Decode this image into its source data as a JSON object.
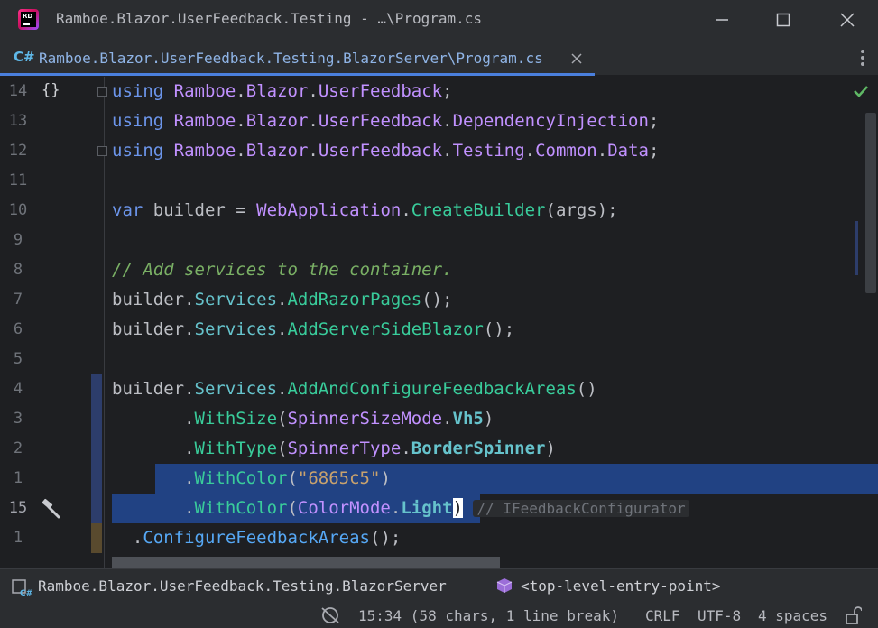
{
  "window": {
    "title": "Ramboe.Blazor.UserFeedback.Testing - …\\Program.cs",
    "app_logo_text": "RD"
  },
  "tab": {
    "lang_icon": "C#",
    "label": "Ramboe.Blazor.UserFeedback.Testing.BlazorServer\\Program.cs"
  },
  "editor": {
    "line_numbers": [
      "14",
      "13",
      "12",
      "11",
      "10",
      "9",
      "8",
      "7",
      "6",
      "5",
      "4",
      "3",
      "2",
      "1",
      "15",
      "1"
    ],
    "inlay_hint": "// IFeedbackConfigurator"
  },
  "navbar": {
    "project": "Ramboe.Blazor.UserFeedback.Testing.BlazorServer",
    "entry_point": "<top-level-entry-point>"
  },
  "status": {
    "position": "15:34 (58 chars, 1 line break)",
    "line_ending": "CRLF",
    "encoding": "UTF-8",
    "indent": "4 spaces"
  },
  "colors": {
    "accent": "#4a7fdd",
    "selection": "#214283",
    "background": "#1e1f22",
    "chrome": "#2b2d30"
  },
  "icons": [
    "rider-logo",
    "minimize-icon",
    "maximize-icon",
    "close-icon",
    "tab-close-icon",
    "more-vertical-icon",
    "braces-icon",
    "hammer-icon",
    "check-icon",
    "project-csharp-icon",
    "cube-icon",
    "no-inspections-icon",
    "lock-icon"
  ]
}
